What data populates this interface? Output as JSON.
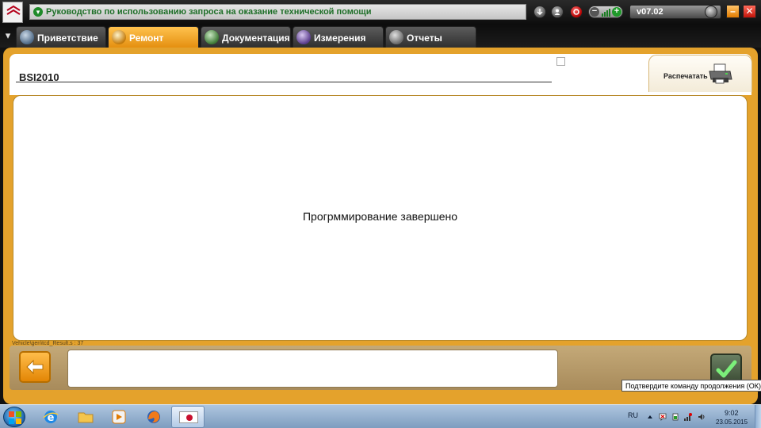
{
  "app": {
    "title": "Руководство по использованию запроса на оказание технической помощи",
    "version": "v07.02"
  },
  "tabs": [
    {
      "label": "Приветствие",
      "icon": "globe-icon",
      "active": false
    },
    {
      "label": "Ремонт",
      "icon": "magnifier-icon",
      "active": true
    },
    {
      "label": "Документация",
      "icon": "book-icon",
      "active": false
    },
    {
      "label": "Измерения",
      "icon": "waveform-icon",
      "active": false
    },
    {
      "label": "Отчеты",
      "icon": "document-icon",
      "active": false
    }
  ],
  "page": {
    "title": "BSI2010",
    "print_label": "Распечатать",
    "status_message": "Прогрммирование завершено",
    "vehicle_path": "Vehicle\\gen\\tcd_Result.s : 37",
    "ok_tooltip": "Подтвердите команду продолжения (ОК)"
  },
  "taskbar": {
    "language": "RU",
    "time": "9:02",
    "date": "23.05.2015"
  },
  "colors": {
    "accent": "#e4a22c",
    "active_tab": "#f2a72b",
    "title_text": "#1d6e27",
    "bottom_bar": "#b89c6b"
  }
}
